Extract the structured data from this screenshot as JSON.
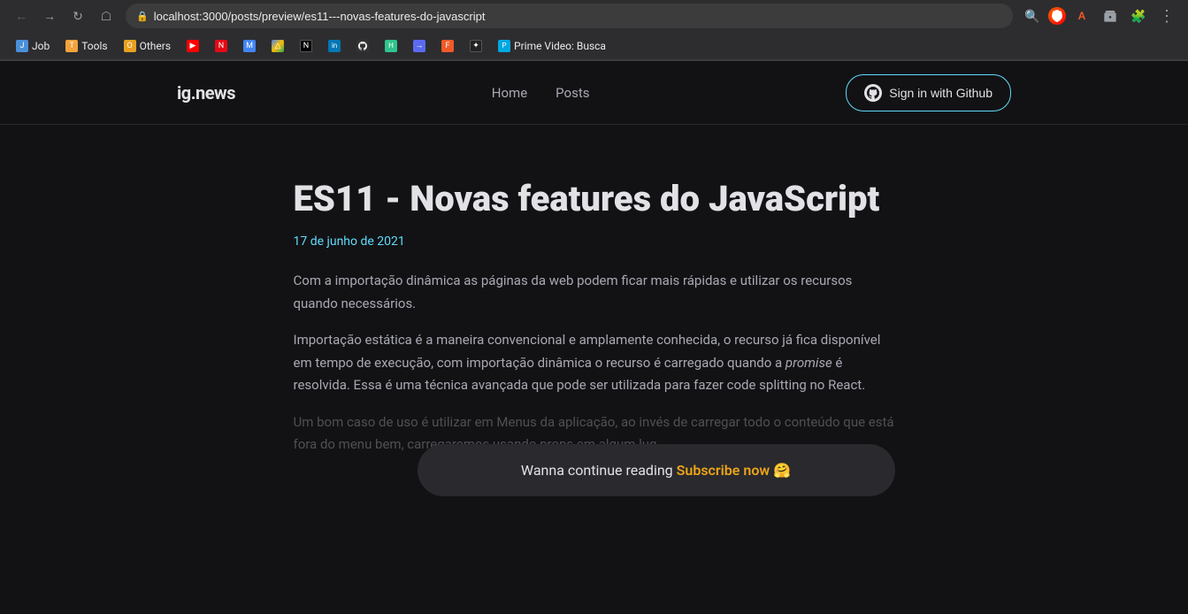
{
  "browser": {
    "url": "localhost:3000/posts/preview/es11---novas-features-do-javascript",
    "nav_back": "←",
    "nav_forward": "→",
    "nav_reload": "↺",
    "nav_home": "⌂",
    "magnify_icon": "🔍"
  },
  "bookmarks": [
    {
      "id": "job",
      "label": "Job",
      "fav_class": "fav-job"
    },
    {
      "id": "tools",
      "label": "Tools",
      "fav_class": "fav-tools"
    },
    {
      "id": "others",
      "label": "Others",
      "fav_class": "fav-others"
    },
    {
      "id": "youtube",
      "label": "",
      "fav_class": "fav-youtube",
      "symbol": "▶"
    },
    {
      "id": "netflix",
      "label": "",
      "fav_class": "fav-netflix",
      "symbol": "N"
    },
    {
      "id": "gmail",
      "label": "",
      "fav_class": "fav-gmail",
      "symbol": "M"
    },
    {
      "id": "gdrive",
      "label": "",
      "fav_class": "fav-gdrive",
      "symbol": "△"
    },
    {
      "id": "notion",
      "label": "",
      "fav_class": "fav-notion",
      "symbol": "N"
    },
    {
      "id": "linkedin",
      "label": "",
      "fav_class": "fav-linkedin",
      "symbol": "in"
    },
    {
      "id": "github",
      "label": "",
      "fav_class": "fav-github",
      "symbol": "⬡"
    },
    {
      "id": "hoppscotch",
      "label": "",
      "fav_class": "fav-hoppscotch",
      "symbol": "H"
    },
    {
      "id": "arrow",
      "label": "",
      "fav_class": "fav-arrow",
      "symbol": "→"
    },
    {
      "id": "feeder",
      "label": "",
      "fav_class": "fav-feeder",
      "symbol": "F"
    },
    {
      "id": "black",
      "label": "",
      "fav_class": "fav-black",
      "symbol": "✦"
    },
    {
      "id": "prime",
      "label": "Prime Video: Busca",
      "fav_class": "fav-prime",
      "symbol": "P"
    }
  ],
  "header": {
    "logo": "ig.news",
    "nav_home": "Home",
    "nav_posts": "Posts",
    "sign_in_label": "Sign in with Github"
  },
  "article": {
    "title": "ES11 - Novas features do JavaScript",
    "date": "17 de junho de 2021",
    "paragraph1": "Com a importação dinâmica as páginas da web podem ficar mais rápidas e utilizar os recursos quando necessários.",
    "paragraph2_before_italic": "Importação estática é a maneira convencional e amplamente conhecida, o recurso já fica disponível em tempo de execução, com importação dinâmica o recurso é carregado quando a ",
    "paragraph2_italic": "promise",
    "paragraph2_after_italic": " é resolvida. Essa é uma técnica avançada que pode ser utilizada para fazer code splitting no React.",
    "paragraph3_faded": "Um bom caso de uso é utilizar em Menus da aplicação, ao invés de carregar todo o conteúdo que está fora do menu bem, carregaremos usando props em algum lug..."
  },
  "subscribe_cta": {
    "text": "Wanna continue reading ",
    "link_text": "Subscribe now",
    "emoji": "🤗"
  }
}
